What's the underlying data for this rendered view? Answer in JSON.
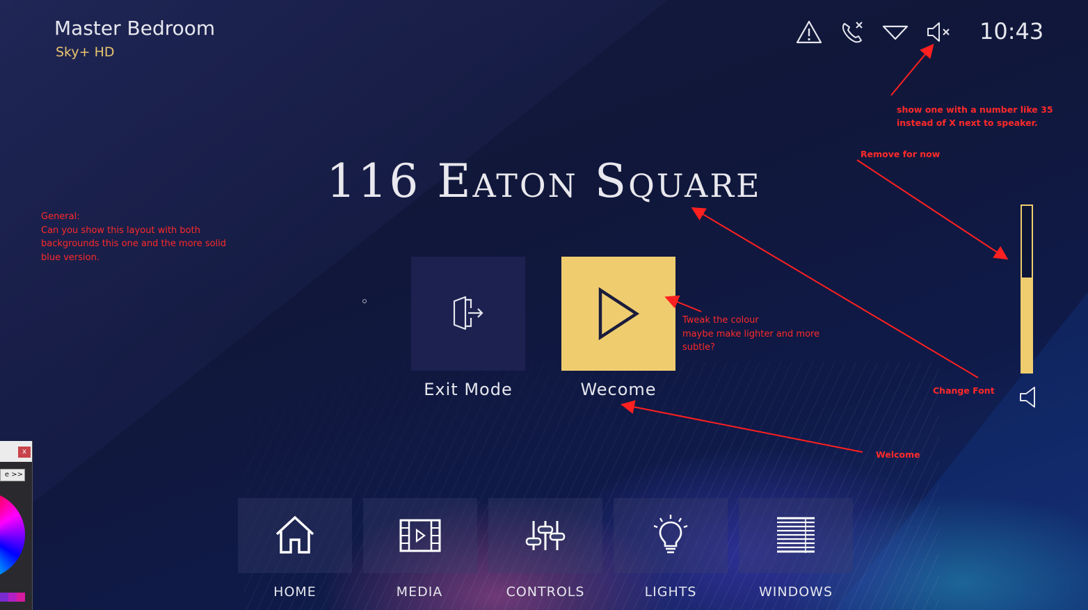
{
  "header": {
    "room": "Master Bedroom",
    "source": "Sky+ HD",
    "clock": "10:43"
  },
  "status_icons": [
    "warning-icon",
    "call-ended-icon",
    "wifi-icon",
    "speaker-muted-icon"
  ],
  "site": {
    "title": "116 Eaton Square"
  },
  "modes": [
    {
      "label": "Exit Mode",
      "icon": "exit-door-icon"
    },
    {
      "label": "Wecome",
      "icon": "play-icon"
    }
  ],
  "volume": {
    "level": 0.57
  },
  "nav": [
    {
      "label": "HOME",
      "icon": "home-icon"
    },
    {
      "label": "MEDIA",
      "icon": "media-film-icon"
    },
    {
      "label": "CONTROLS",
      "icon": "sliders-icon"
    },
    {
      "label": "LIGHTS",
      "icon": "lightbulb-icon"
    },
    {
      "label": "WINDOWS",
      "icon": "blinds-icon"
    }
  ],
  "annotations": {
    "general": [
      "General:",
      "Can you show this layout with both",
      "backgrounds this one and the more solid",
      "blue version."
    ],
    "speaker": [
      "show one with a number like 35",
      "instead of X next to speaker."
    ],
    "remove": "Remove for now",
    "colour": [
      "Tweak the colour",
      "maybe make lighter and more",
      "subtle?"
    ],
    "font": "Change Font",
    "welcome": "Welcome"
  },
  "colors": {
    "accent": "#efcd6f",
    "annotation": "#ff2a2a",
    "background": "#10173a"
  },
  "picker": {
    "close": "x",
    "more": "e >>"
  }
}
